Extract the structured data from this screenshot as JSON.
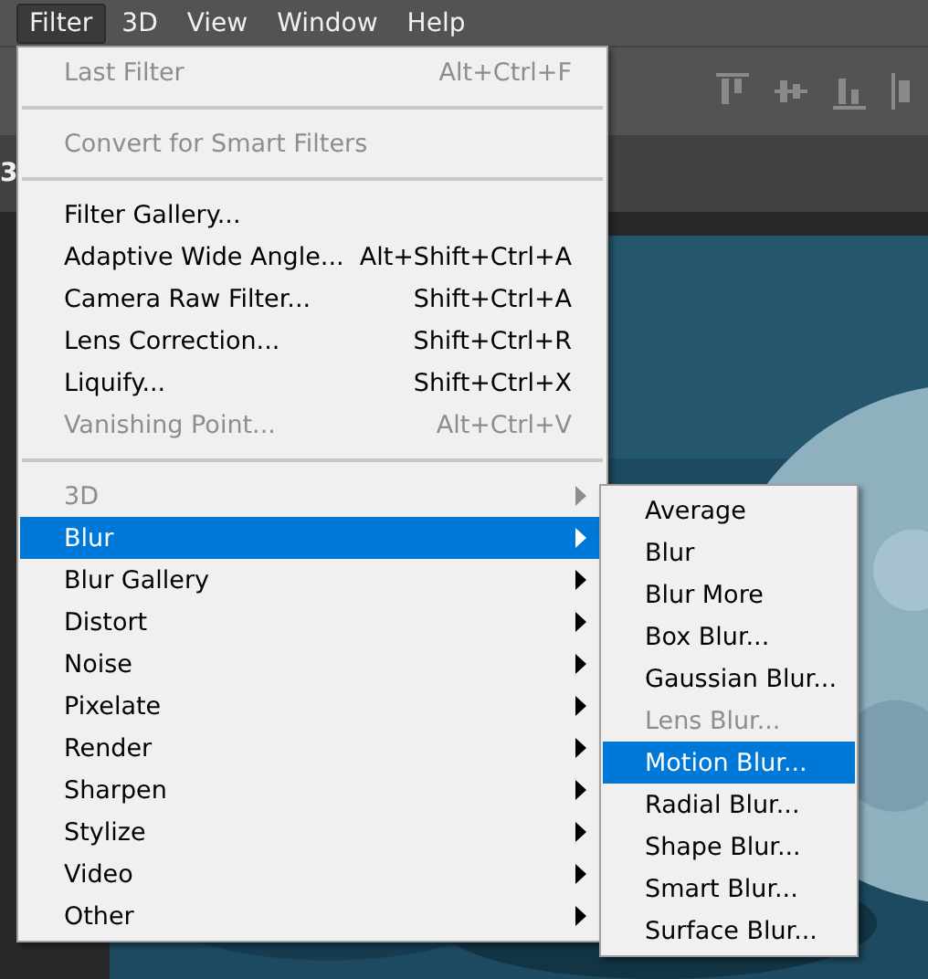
{
  "menu_bar": [
    {
      "label": "Filter",
      "selected": true
    },
    {
      "label": "3D",
      "selected": false
    },
    {
      "label": "View",
      "selected": false
    },
    {
      "label": "Window",
      "selected": false
    },
    {
      "label": "Help",
      "selected": false
    }
  ],
  "document_tab": {
    "label": "3"
  },
  "filter_menu": [
    {
      "kind": "item",
      "label": "Last Filter",
      "shortcut": "Alt+Ctrl+F",
      "disabled": true,
      "selected": false,
      "submenu": false
    },
    {
      "kind": "separator"
    },
    {
      "kind": "item",
      "label": "Convert for Smart Filters",
      "disabled": true,
      "selected": false,
      "submenu": false
    },
    {
      "kind": "separator"
    },
    {
      "kind": "item",
      "label": "Filter Gallery...",
      "disabled": false,
      "selected": false,
      "submenu": false
    },
    {
      "kind": "item",
      "label": "Adaptive Wide Angle...",
      "shortcut": "Alt+Shift+Ctrl+A",
      "disabled": false,
      "selected": false,
      "submenu": false
    },
    {
      "kind": "item",
      "label": "Camera Raw Filter...",
      "shortcut": "Shift+Ctrl+A",
      "disabled": false,
      "selected": false,
      "submenu": false
    },
    {
      "kind": "item",
      "label": "Lens Correction...",
      "shortcut": "Shift+Ctrl+R",
      "disabled": false,
      "selected": false,
      "submenu": false
    },
    {
      "kind": "item",
      "label": "Liquify...",
      "shortcut": "Shift+Ctrl+X",
      "disabled": false,
      "selected": false,
      "submenu": false
    },
    {
      "kind": "item",
      "label": "Vanishing Point...",
      "shortcut": "Alt+Ctrl+V",
      "disabled": true,
      "selected": false,
      "submenu": false
    },
    {
      "kind": "separator"
    },
    {
      "kind": "item",
      "label": "3D",
      "disabled": true,
      "selected": false,
      "submenu": true
    },
    {
      "kind": "item",
      "label": "Blur",
      "disabled": false,
      "selected": true,
      "submenu": true
    },
    {
      "kind": "item",
      "label": "Blur Gallery",
      "disabled": false,
      "selected": false,
      "submenu": true
    },
    {
      "kind": "item",
      "label": "Distort",
      "disabled": false,
      "selected": false,
      "submenu": true
    },
    {
      "kind": "item",
      "label": "Noise",
      "disabled": false,
      "selected": false,
      "submenu": true
    },
    {
      "kind": "item",
      "label": "Pixelate",
      "disabled": false,
      "selected": false,
      "submenu": true
    },
    {
      "kind": "item",
      "label": "Render",
      "disabled": false,
      "selected": false,
      "submenu": true
    },
    {
      "kind": "item",
      "label": "Sharpen",
      "disabled": false,
      "selected": false,
      "submenu": true
    },
    {
      "kind": "item",
      "label": "Stylize",
      "disabled": false,
      "selected": false,
      "submenu": true
    },
    {
      "kind": "item",
      "label": "Video",
      "disabled": false,
      "selected": false,
      "submenu": true
    },
    {
      "kind": "item",
      "label": "Other",
      "disabled": false,
      "selected": false,
      "submenu": true
    }
  ],
  "blur_submenu": [
    {
      "label": "Average",
      "disabled": false,
      "selected": false
    },
    {
      "label": "Blur",
      "disabled": false,
      "selected": false
    },
    {
      "label": "Blur More",
      "disabled": false,
      "selected": false
    },
    {
      "label": "Box Blur...",
      "disabled": false,
      "selected": false
    },
    {
      "label": "Gaussian Blur...",
      "disabled": false,
      "selected": false
    },
    {
      "label": "Lens Blur...",
      "disabled": true,
      "selected": false
    },
    {
      "label": "Motion Blur...",
      "disabled": false,
      "selected": true
    },
    {
      "label": "Radial Blur...",
      "disabled": false,
      "selected": false
    },
    {
      "label": "Shape Blur...",
      "disabled": false,
      "selected": false
    },
    {
      "label": "Smart Blur...",
      "disabled": false,
      "selected": false
    },
    {
      "label": "Surface Blur...",
      "disabled": false,
      "selected": false
    }
  ]
}
